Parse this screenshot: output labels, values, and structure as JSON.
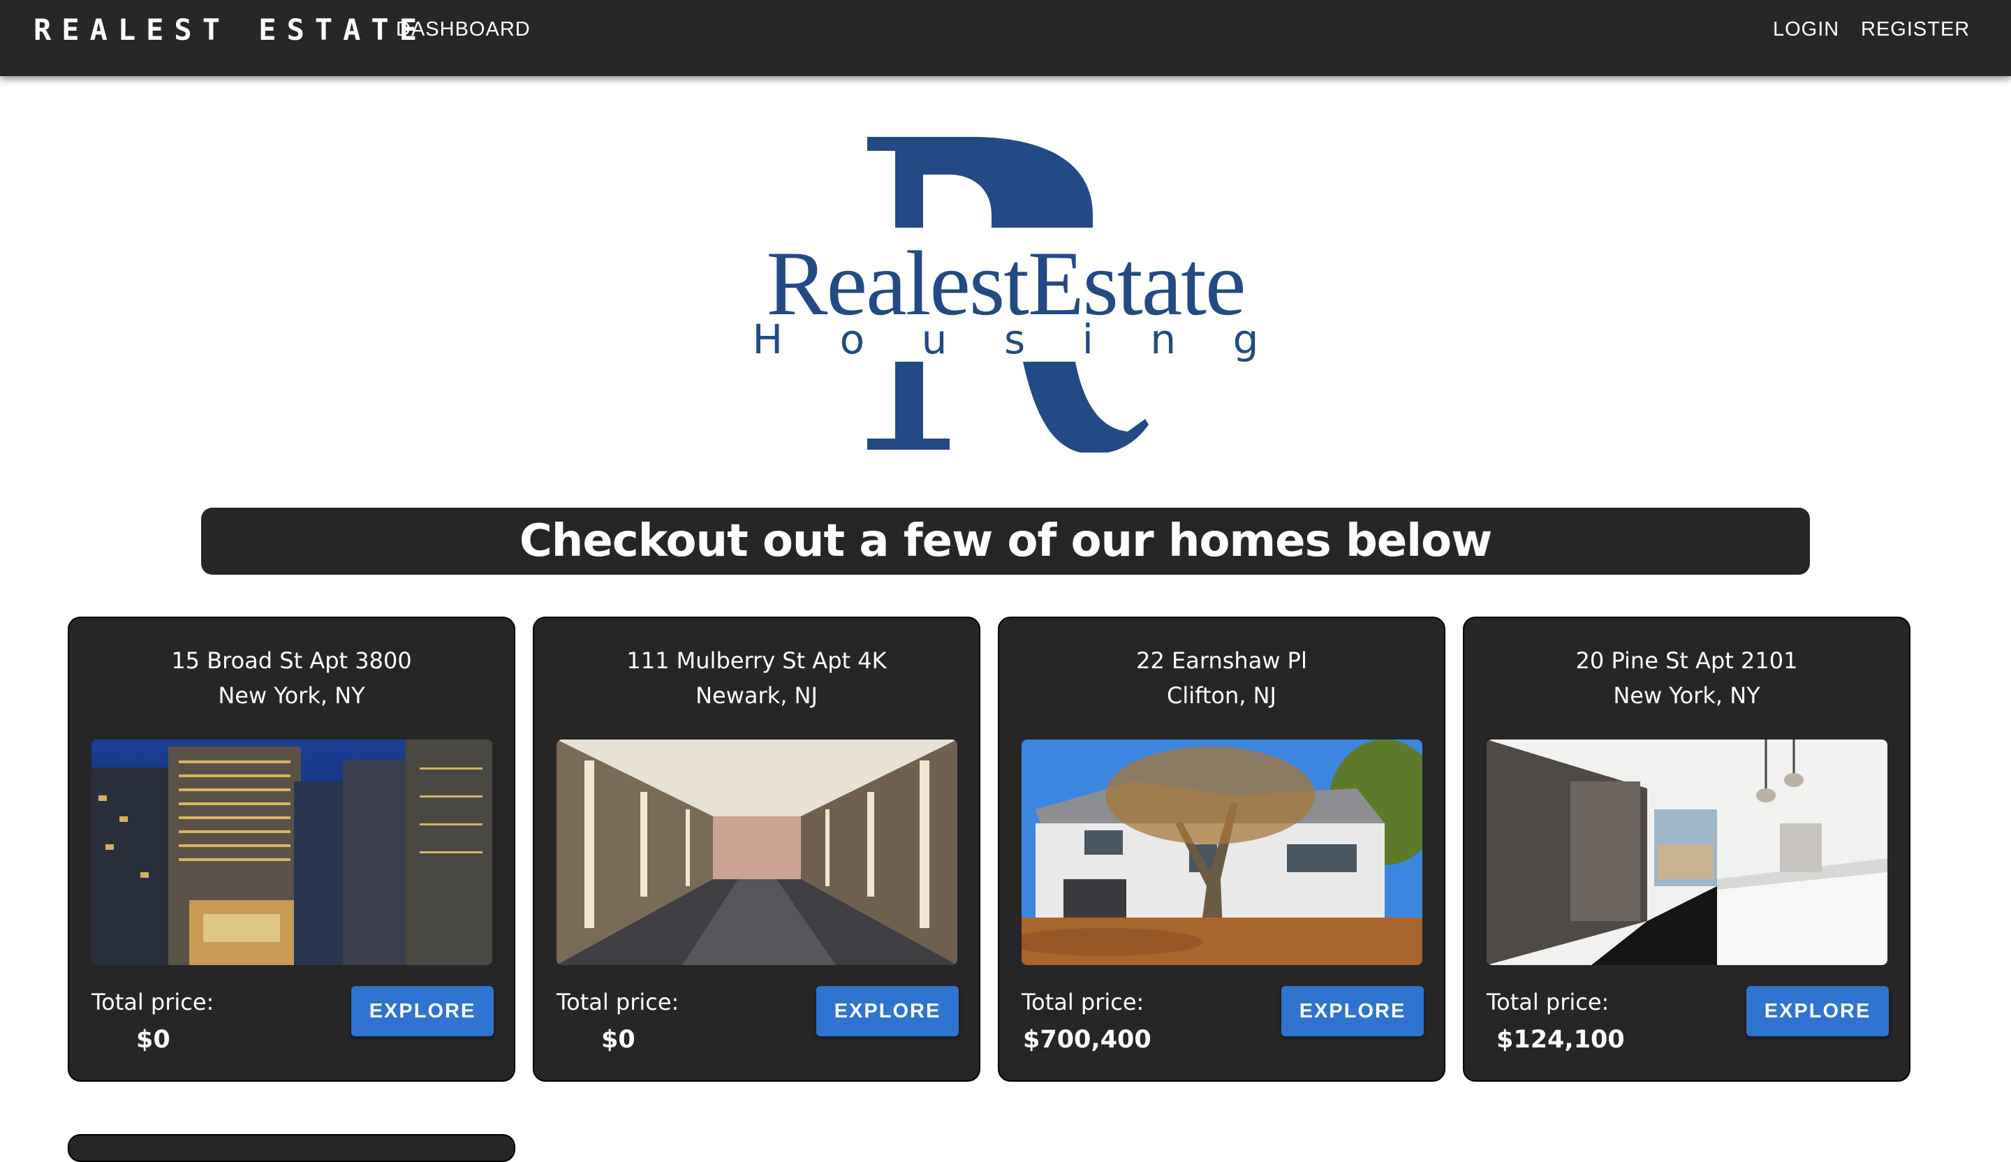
{
  "header": {
    "brand": "REALEST ESTATE",
    "nav": {
      "dashboard": "DASHBOARD",
      "login": "LOGIN",
      "register": "REGISTER"
    }
  },
  "logo": {
    "text": "RealestEstate",
    "subtext": "H o u s i n g",
    "letter": "R",
    "color": "#234a84"
  },
  "headline": "Checkout out a few of our homes below",
  "listings": [
    {
      "street": "15 Broad St Apt 3800",
      "city": "New York, NY",
      "price_label": "Total price:",
      "price": "$0",
      "button": "EXPLORE",
      "photo": "city-night-skyline"
    },
    {
      "street": "111 Mulberry St Apt 4K",
      "city": "Newark, NJ",
      "price_label": "Total price:",
      "price": "$0",
      "button": "EXPLORE",
      "photo": "marble-hallway"
    },
    {
      "street": "22 Earnshaw Pl",
      "city": "Clifton, NJ",
      "price_label": "Total price:",
      "price": "$700,400",
      "button": "EXPLORE",
      "photo": "white-house-with-tree"
    },
    {
      "street": "20 Pine St Apt 2101",
      "city": "New York, NY",
      "price_label": "Total price:",
      "price": "$124,100",
      "button": "EXPLORE",
      "photo": "modern-kitchen"
    }
  ],
  "colors": {
    "topbar": "#272727",
    "card": "#262626",
    "button": "#2f74d0"
  }
}
